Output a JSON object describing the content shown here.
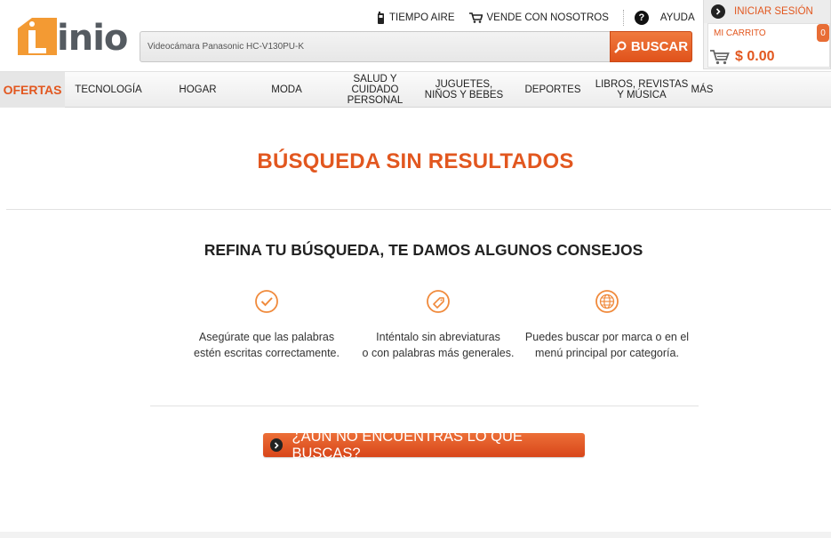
{
  "brand": {
    "name": "Linio",
    "logo_text": "inio",
    "accent_color": "#e2571f"
  },
  "toplinks": [
    {
      "label": "TIEMPO AIRE",
      "icon": "phone-icon"
    },
    {
      "label": "VENDE CON NOSOTROS",
      "icon": "cart-icon"
    },
    {
      "label": "AYUDA",
      "icon": "help-icon"
    }
  ],
  "search": {
    "value": "Videocámara Panasonic HC-V130PU-K",
    "button_label": "BUSCAR"
  },
  "account": {
    "login_label": "INICIAR SESIÓN",
    "cart_label": "MI CARRITO",
    "cart_count": "0",
    "cart_total": "$ 0.00"
  },
  "nav": {
    "items": [
      {
        "lines": [
          "OFERTAS"
        ]
      },
      {
        "lines": [
          "TECNOLOGÍA"
        ]
      },
      {
        "lines": [
          "HOGAR"
        ]
      },
      {
        "lines": [
          "MODA"
        ]
      },
      {
        "lines": [
          "SALUD Y",
          "CUIDADO",
          "PERSONAL"
        ]
      },
      {
        "lines": [
          "JUGUETES,",
          "NIÑOS Y BEBES"
        ]
      },
      {
        "lines": [
          "DEPORTES"
        ]
      },
      {
        "lines": [
          "LIBROS, REVISTAS",
          "Y MÚSICA"
        ]
      },
      {
        "lines": [
          "MÁS"
        ]
      }
    ]
  },
  "main": {
    "title": "BÚSQUEDA SIN RESULTADOS",
    "subtitle": "REFINA TU BÚSQUEDA, TE DAMOS ALGUNOS CONSEJOS",
    "tips": [
      {
        "icon": "check-circle-icon",
        "lines": [
          "Asegúrate que las palabras",
          "estén escritas correctamente."
        ]
      },
      {
        "icon": "tag-circle-icon",
        "lines": [
          "Inténtalo sin abreviaturas",
          "o con palabras más generales."
        ]
      },
      {
        "icon": "globe-circle-icon",
        "lines": [
          "Puedes buscar por marca o en el",
          "menú principal por categoría."
        ]
      }
    ],
    "cta_label": "¿AÚN NO ENCUENTRAS LO QUE BUSCAS?"
  }
}
